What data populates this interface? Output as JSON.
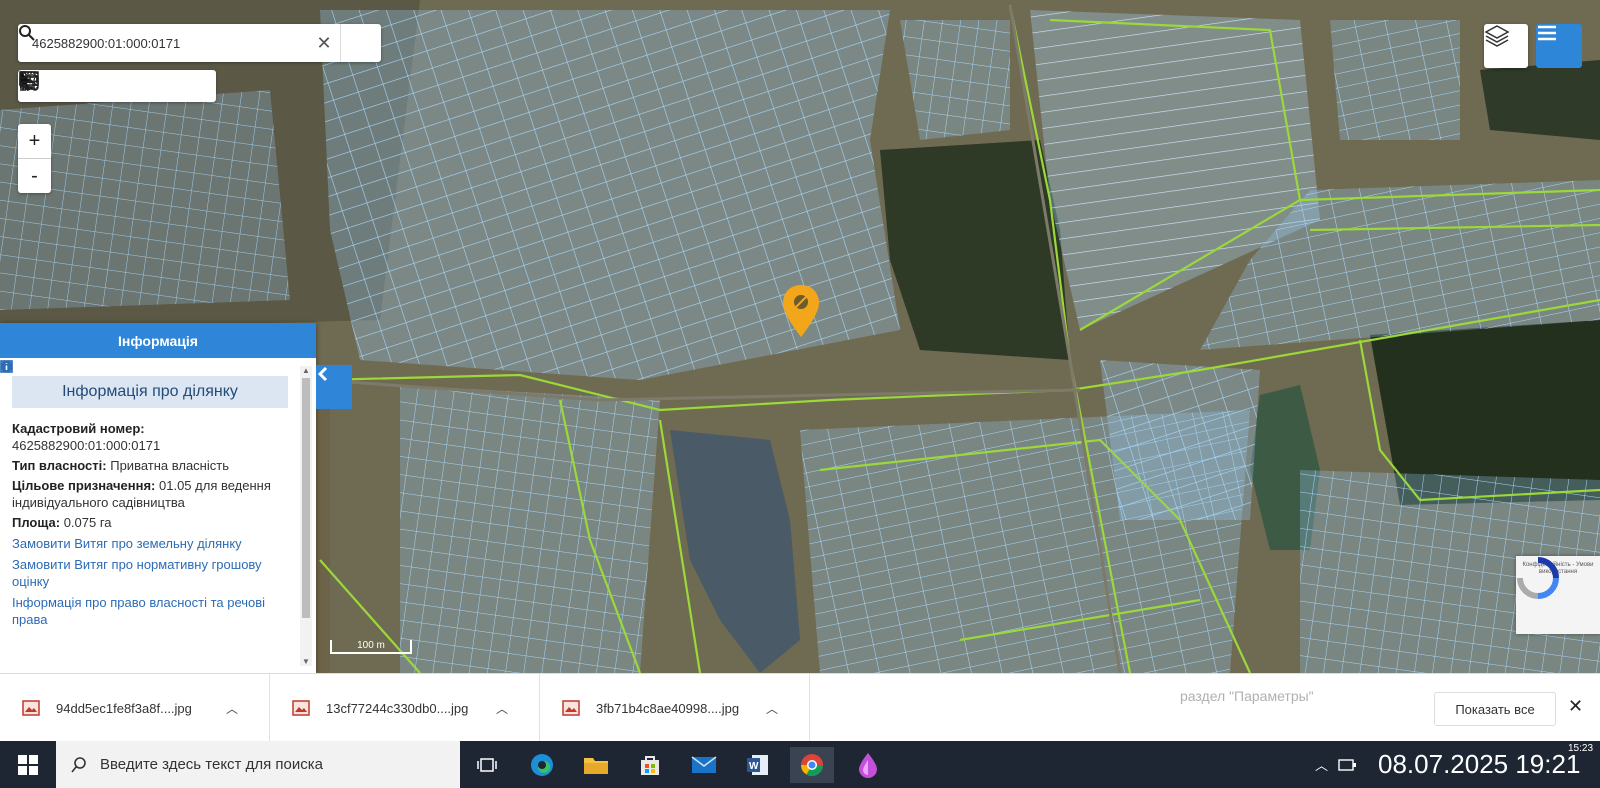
{
  "search": {
    "value": "4625882900:01:000:0171"
  },
  "toolbar": {
    "tools": [
      "print-icon",
      "measure-distance-icon",
      "measure-area-icon",
      "pointer-icon",
      "identify-icon",
      "route-icon"
    ]
  },
  "zoom": {
    "in": "+",
    "out": "-"
  },
  "map": {
    "scale_label": "100 m"
  },
  "info_panel": {
    "header": "Інформація",
    "title": "Інформація про ділянку",
    "cadastral_label": "Кадастровий номер:",
    "cadastral_value": "4625882900:01:000:0171",
    "ownership_label": "Тип власності:",
    "ownership_value": "Приватна власність",
    "purpose_label": "Цільове призначення:",
    "purpose_value": "01.05 для ведення індивідуального садівництва",
    "area_label": "Площа:",
    "area_value": "0.075 га",
    "link_extract_land": "Замовити Витяг про земельну ділянку",
    "link_extract_valuation": "Замовити Витяг про нормативну грошову оцінку",
    "link_rights": "Інформація про право власності та речові права"
  },
  "recaptcha": {
    "text": "Конфіденційність - Умови використання"
  },
  "downloads": {
    "items": [
      {
        "name": "94dd5ec1fe8f3a8f....jpg"
      },
      {
        "name": "13cf77244c330db0....jpg"
      },
      {
        "name": "3fb71b4c8ae40998....jpg"
      }
    ],
    "ghost_text": "раздел \"Параметры\"",
    "show_all": "Показать все",
    "close": "✕"
  },
  "taskbar": {
    "search_placeholder": "Введите здесь текст для поиска",
    "apps": [
      "task-view-icon",
      "edge-icon",
      "file-explorer-icon",
      "store-icon",
      "mail-icon",
      "word-icon",
      "chrome-icon",
      "drop-app-icon"
    ],
    "clock_time_small": "15:23",
    "clock_overlay": "08.07.2025 19:21"
  },
  "colors": {
    "accent": "#2f86d8",
    "parcel_stroke": "#9fd0f5",
    "boundary_green": "#9bd83a",
    "marker": "#f2a619"
  }
}
